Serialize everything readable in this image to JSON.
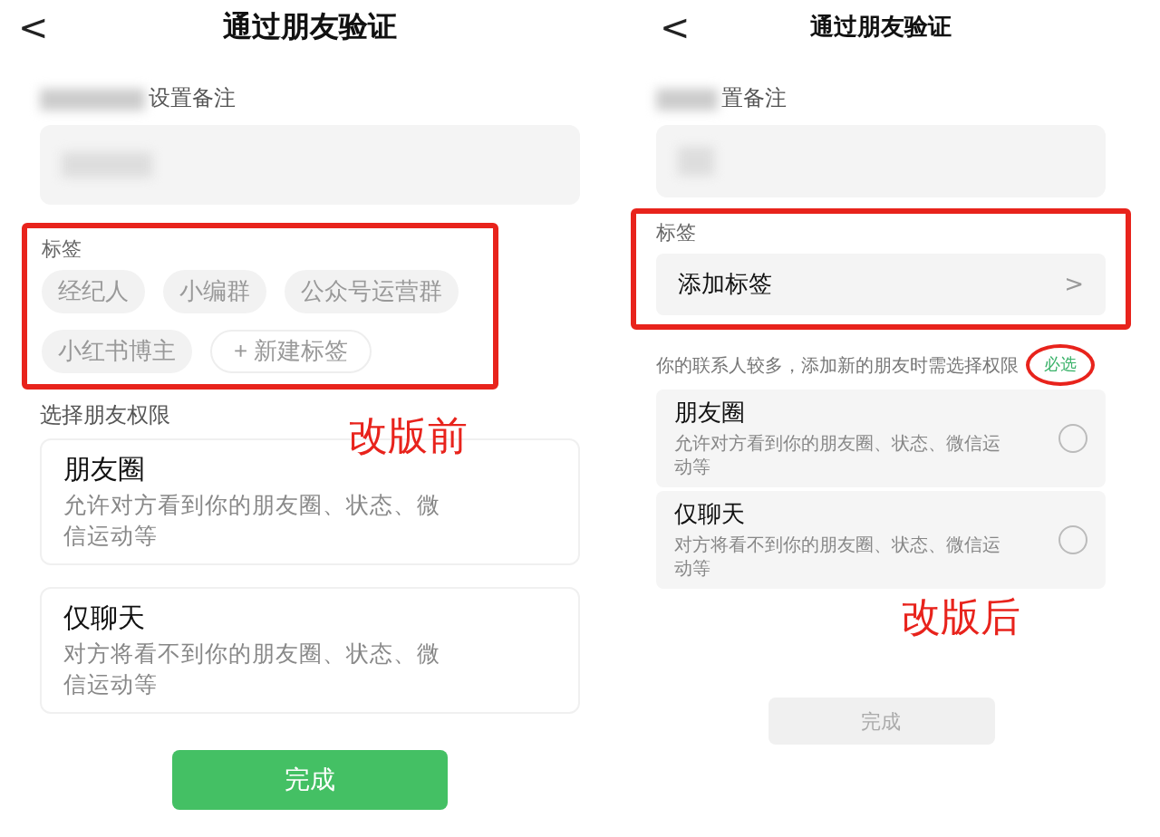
{
  "before": {
    "title": "通过朋友验证",
    "back": "<",
    "remark_label": "设置备注",
    "tags": {
      "label": "标签",
      "highlighted": true,
      "chips": [
        {
          "text": "经纪人",
          "kind": "tag"
        },
        {
          "text": "小编群",
          "kind": "tag"
        },
        {
          "text": "公众号运营群",
          "kind": "tag"
        },
        {
          "text": "小红书博主",
          "kind": "tag"
        },
        {
          "text": "+ 新建标签",
          "kind": "new"
        }
      ]
    },
    "permissions_label": "选择朋友权限",
    "options": [
      {
        "title": "朋友圈",
        "desc": "允许对方看到你的朋友圈、状态、微信运动等"
      },
      {
        "title": "仅聊天",
        "desc": "对方将看不到你的朋友圈、状态、微信运动等"
      }
    ],
    "done": {
      "text": "完成",
      "disabled": false
    },
    "note": "改版前"
  },
  "after": {
    "title": "通过朋友验证",
    "back": "<",
    "remark_label": "置备注",
    "tags": {
      "label": "标签",
      "highlighted": true,
      "add": "添加标签",
      "chevron": ">"
    },
    "permissions_label": "你的联系人较多，添加新的朋友时需选择权限",
    "required": {
      "text": "必选",
      "circled": true
    },
    "options": [
      {
        "title": "朋友圈",
        "desc": "允许对方看到你的朋友圈、状态、微信运动等",
        "selected": false
      },
      {
        "title": "仅聊天",
        "desc": "对方将看不到你的朋友圈、状态、微信运动等",
        "selected": false
      }
    ],
    "done": {
      "text": "完成",
      "disabled": true
    },
    "note": "改版后"
  }
}
